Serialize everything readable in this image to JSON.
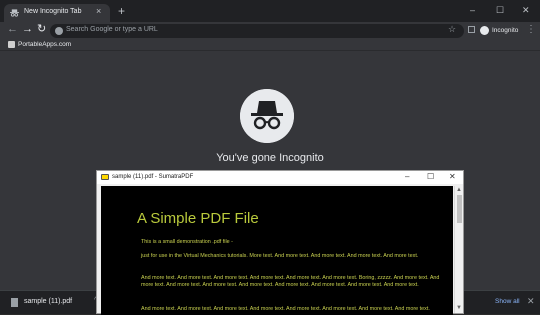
{
  "browser": {
    "tab_title": "New Incognito Tab",
    "tab_close": "×",
    "new_tab": "+",
    "window_controls": {
      "minimize": "–",
      "maximize": "☐",
      "close": "✕"
    },
    "nav": {
      "back": "←",
      "forward": "→",
      "reload": "↻"
    },
    "omnibox_placeholder": "Search Google or type a URL",
    "star": "☆",
    "incognito_label": "Incognito",
    "menu": "⋮",
    "bookmark_label": "PortableApps.com",
    "headline": "You've gone Incognito",
    "colors": {
      "frame": "#202124",
      "toolbar": "#35363a",
      "text": "#e8eaed",
      "link": "#8ab4f8"
    }
  },
  "download_bar": {
    "filename": "sample (11).pdf",
    "chevron": "^",
    "show_all": "Show all",
    "close": "✕"
  },
  "pdf_window": {
    "title": "sample (11).pdf - SumatraPDF",
    "controls": {
      "minimize": "–",
      "maximize": "☐",
      "close": "✕"
    },
    "heading": "A Simple PDF File",
    "paragraphs": [
      "This is a small demonstration .pdf file -",
      "just for use in the Virtual Mechanics tutorials. More text. And more text. And more text. And more text. And more text.",
      "And more text. And more text. And more text. And more text. And more text. And more text. Boring, zzzzz. And more text. And more text. And more text. And more text. And more text. And more text. And more text. And more text. And more text.",
      "And more text. And more text. And more text. And more text. And more text. And more text. And more text. And more text."
    ],
    "colors": {
      "background": "#000000",
      "text": "#c9d150"
    }
  }
}
